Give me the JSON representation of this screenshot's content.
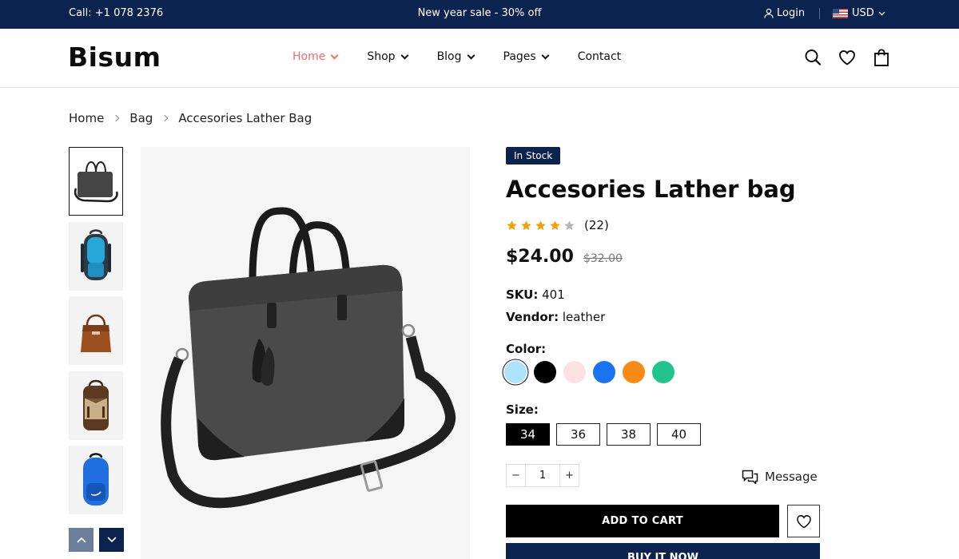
{
  "topbar": {
    "call": "Call: +1 078 2376",
    "promo": "New year sale - 30% off",
    "login": "Login",
    "currency": "USD"
  },
  "header": {
    "logo": "Bisum",
    "nav": [
      {
        "label": "Home",
        "active": true
      },
      {
        "label": "Shop"
      },
      {
        "label": "Blog"
      },
      {
        "label": "Pages"
      },
      {
        "label": "Contact"
      }
    ],
    "icons": [
      "search-icon",
      "heart-icon",
      "shopping-bag-icon"
    ]
  },
  "breadcrumb": [
    "Home",
    "Bag",
    "Accesories Lather Bag"
  ],
  "gallery": {
    "thumbnails": [
      "black-laptop-bag",
      "blue-backpack",
      "brown-handbag",
      "brown-rucksack",
      "blue-sport-backpack"
    ],
    "selected_index": 0
  },
  "product": {
    "badge": "In Stock",
    "title": "Accesories Lather bag",
    "rating": 4,
    "rating_max": 5,
    "review_count": "(22)",
    "price": "$24.00",
    "old_price": "$32.00",
    "sku_label": "SKU:",
    "sku": "401",
    "vendor_label": "Vendor:",
    "vendor": "leather",
    "color_label": "Color:",
    "colors": [
      "#aee4fb",
      "#000000",
      "#fde0e3",
      "#1a73f0",
      "#f98a15",
      "#22c48e"
    ],
    "size_label": "Size:",
    "sizes": [
      "34",
      "36",
      "38",
      "40"
    ],
    "selected_size": "34",
    "quantity": "1",
    "minus": "−",
    "plus": "+",
    "message_label": "Message",
    "add_to_cart": "ADD TO CART",
    "buy_now": "BUY IT NOW"
  },
  "colors": {
    "navy": "#0c2350",
    "accent": "#ef6d6d",
    "star": "#f4a000",
    "star_empty": "#b5b5b5"
  }
}
